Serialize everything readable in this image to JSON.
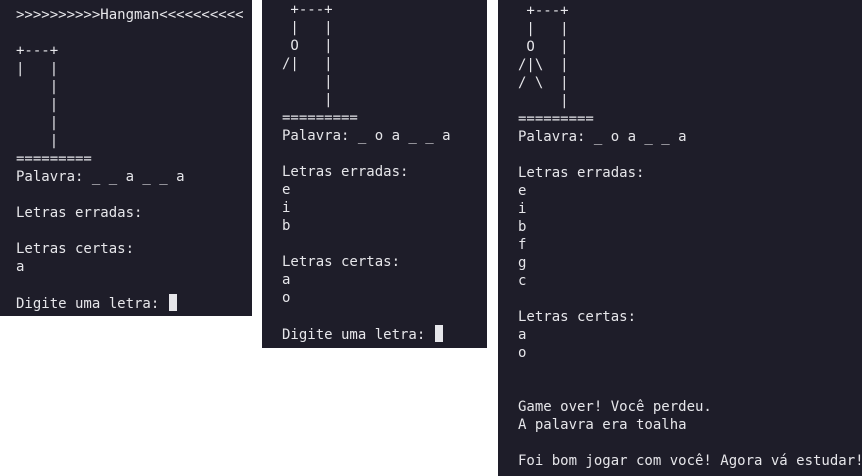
{
  "terminals": [
    {
      "name": "terminal-1",
      "lines": [
        ">>>>>>>>>>Hangman<<<<<<<<<<",
        "",
        "+---+",
        "|   |",
        "    |",
        "    |",
        "    |",
        "    |",
        "=========",
        "Palavra: _ _ a _ _ a",
        "",
        "Letras erradas:",
        "",
        "Letras certas:",
        "a",
        "",
        "Digite uma letra: "
      ],
      "cursor": true
    },
    {
      "name": "terminal-2",
      "lines": [
        " +---+",
        " |   |",
        " O   |",
        "/|   |",
        "     |",
        "     |",
        "=========",
        "Palavra: _ o a _ _ a",
        "",
        "Letras erradas:",
        "e",
        "i",
        "b",
        "",
        "Letras certas:",
        "a",
        "o",
        "",
        "Digite uma letra: "
      ],
      "cursor": true
    },
    {
      "name": "terminal-3",
      "lines": [
        " +---+",
        " |   |",
        " O   |",
        "/|\\  |",
        "/ \\  |",
        "     |",
        "=========",
        "Palavra: _ o a _ _ a",
        "",
        "Letras erradas:",
        "e",
        "i",
        "b",
        "f",
        "g",
        "c",
        "",
        "Letras certas:",
        "a",
        "o",
        "",
        "",
        "Game over! Você perdeu.",
        "A palavra era toalha",
        "",
        "Foi bom jogar com você! Agora vá estudar!"
      ],
      "cursor": false
    }
  ]
}
